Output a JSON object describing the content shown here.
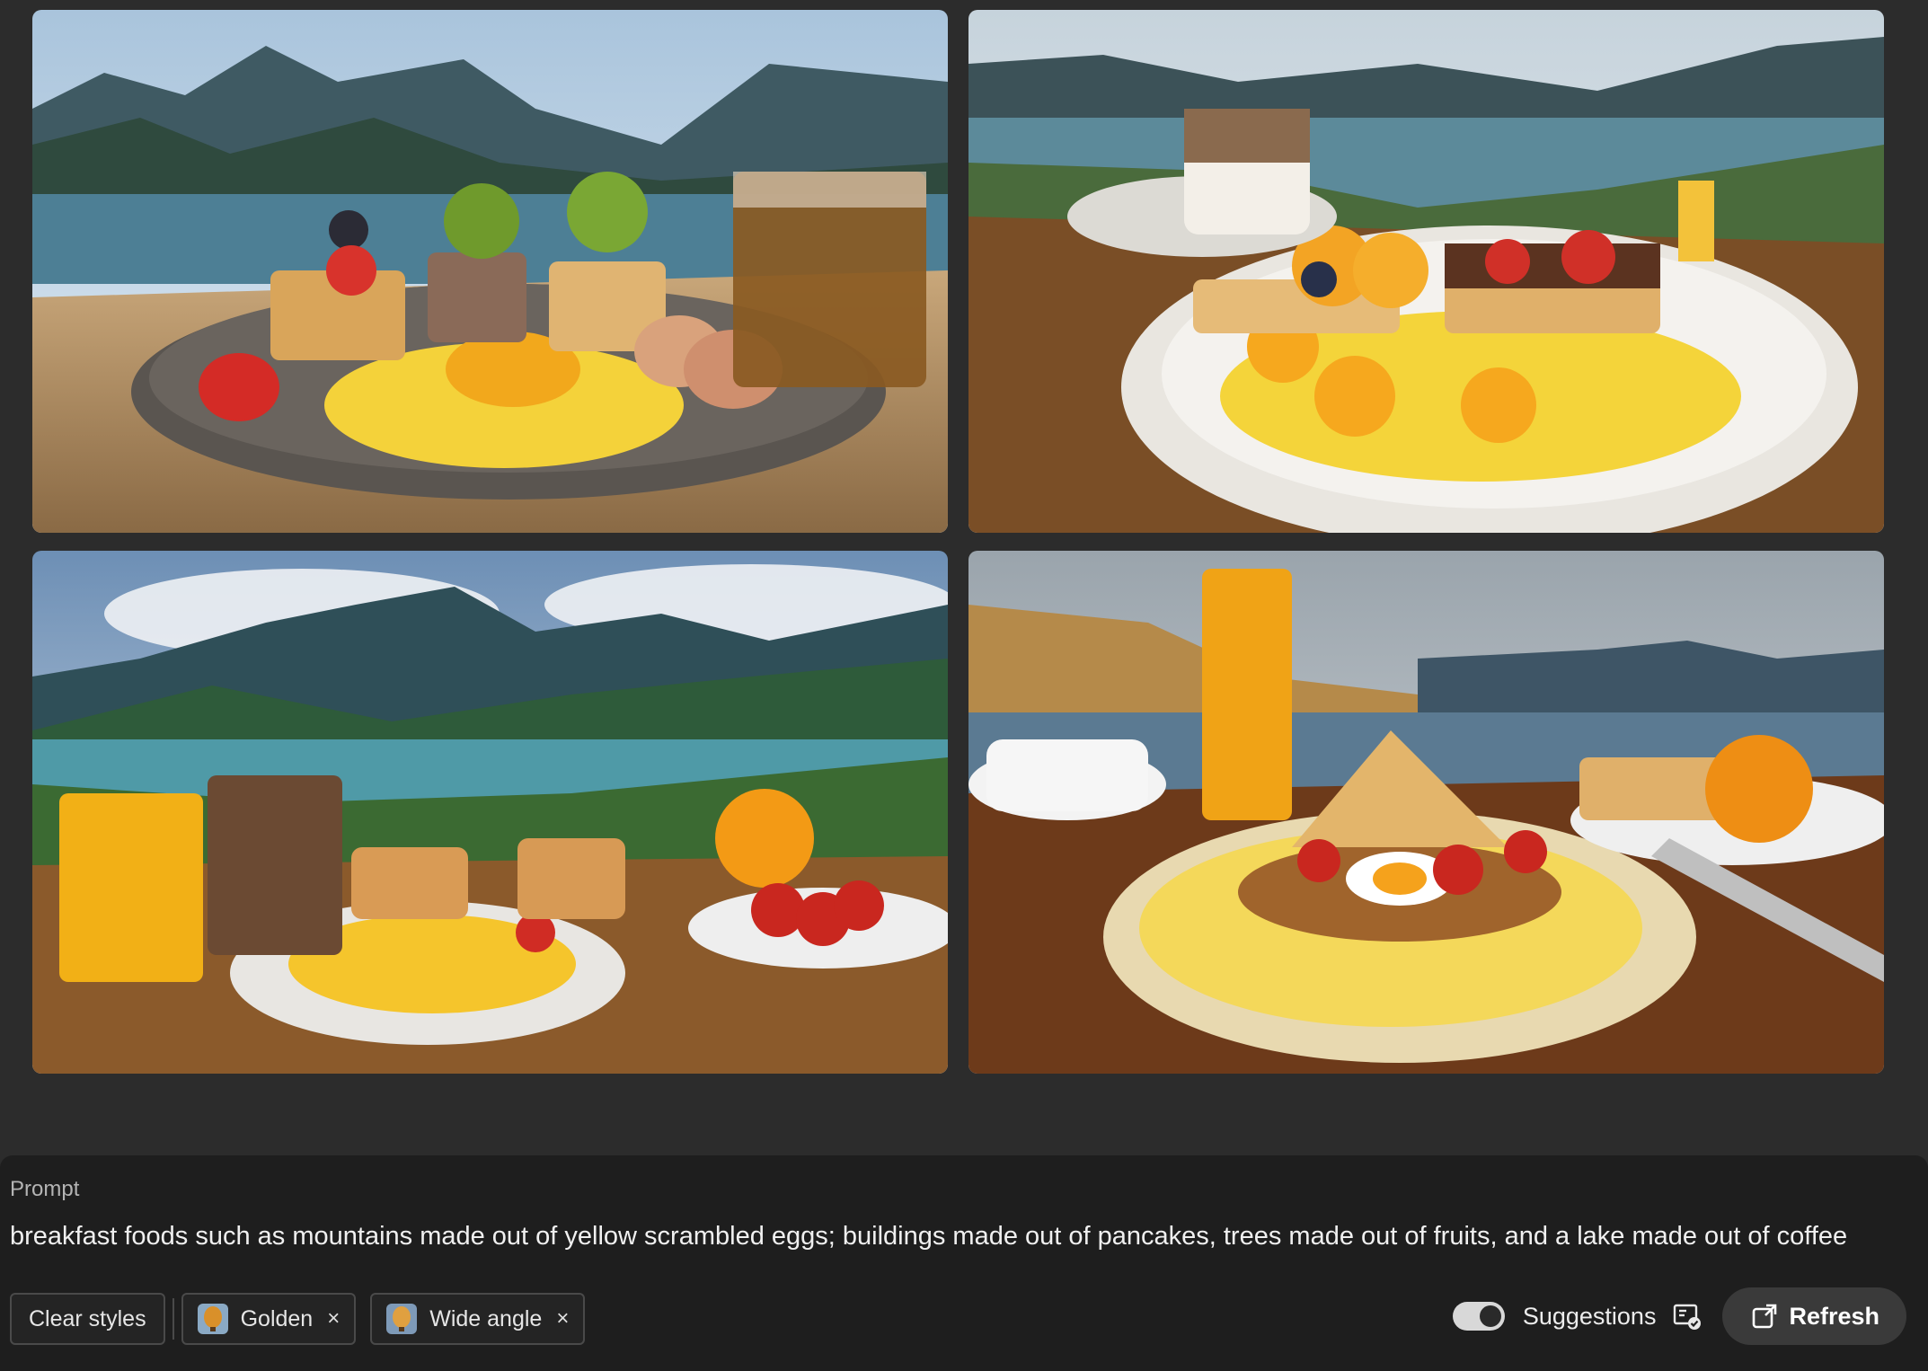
{
  "gallery": {
    "images": [
      {
        "name": "breakfast-mountain-image-1"
      },
      {
        "name": "breakfast-mountain-image-2"
      },
      {
        "name": "breakfast-mountain-image-3"
      },
      {
        "name": "breakfast-mountain-image-4"
      }
    ]
  },
  "prompt": {
    "label": "Prompt",
    "text": "breakfast foods such as mountains made out of yellow scrambled eggs; buildings made out of pancakes, trees made out of fruits, and a lake made out of coffee"
  },
  "styles": {
    "clear_label": "Clear styles",
    "chips": [
      {
        "label": "Golden",
        "icon": "balloon-thumb-icon"
      },
      {
        "label": "Wide angle",
        "icon": "balloon-thumb-icon"
      }
    ],
    "remove_glyph": "×"
  },
  "controls": {
    "suggestions_label": "Suggestions",
    "suggestions_enabled": true,
    "refresh_label": "Refresh"
  }
}
